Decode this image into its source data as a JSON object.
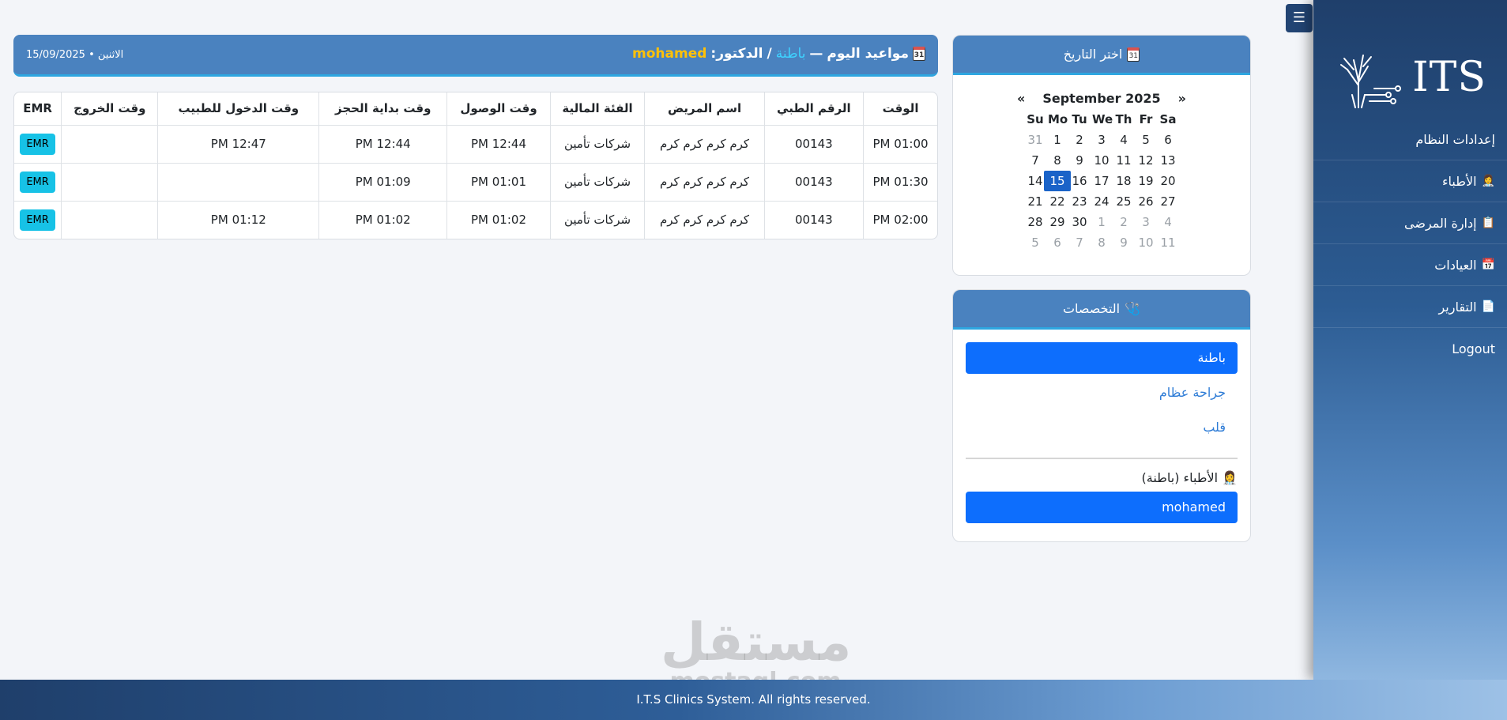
{
  "sidebar": {
    "toggle_icon": "☰",
    "logo_text": "ITS",
    "items": [
      {
        "label": "إعدادات النظام",
        "icon": ""
      },
      {
        "label": "الأطباء",
        "icon": "👩‍⚕️"
      },
      {
        "label": "إدارة المرضى",
        "icon": "📋"
      },
      {
        "label": "العيادات",
        "icon": "📅"
      },
      {
        "label": "التقارير",
        "icon": "📄"
      },
      {
        "label": "Logout",
        "icon": ""
      }
    ]
  },
  "header": {
    "title": "مواعيد اليوم",
    "dash": "—",
    "specialty": "باطنة",
    "separator": "/",
    "doctor_label": "الدكتور:",
    "doctor_name": "mohamed",
    "date": "الاثنين • 15/09/2025",
    "calendar_icon_day": "31"
  },
  "table": {
    "columns": [
      "الوقت",
      "الرقم الطبي",
      "اسم المريض",
      "الفئة المالية",
      "وقت الوصول",
      "وقت بداية الحجز",
      "وقت الدخول للطبيب",
      "وقت الخروج",
      "EMR"
    ],
    "rows": [
      {
        "time": "01:00 PM",
        "mrn": "00143",
        "name": "كرم كرم كرم كرم",
        "category": "شركات تأمين",
        "arrival": "12:44 PM",
        "booking_start": "12:44 PM",
        "doctor_in": "12:47 PM",
        "exit": "",
        "emr": "EMR"
      },
      {
        "time": "01:30 PM",
        "mrn": "00143",
        "name": "كرم كرم كرم كرم",
        "category": "شركات تأمين",
        "arrival": "01:01 PM",
        "booking_start": "01:09 PM",
        "doctor_in": "",
        "exit": "",
        "emr": "EMR"
      },
      {
        "time": "02:00 PM",
        "mrn": "00143",
        "name": "كرم كرم كرم كرم",
        "category": "شركات تأمين",
        "arrival": "01:02 PM",
        "booking_start": "01:02 PM",
        "doctor_in": "01:12 PM",
        "exit": "",
        "emr": "EMR"
      }
    ]
  },
  "calendar": {
    "title": "اختر التاريخ",
    "month_label": "September 2025",
    "prev": "«",
    "next": "»",
    "weekdays": [
      "Su",
      "Mo",
      "Tu",
      "We",
      "Th",
      "Fr",
      "Sa"
    ],
    "days": [
      {
        "d": "31",
        "m": true
      },
      {
        "d": "1"
      },
      {
        "d": "2"
      },
      {
        "d": "3"
      },
      {
        "d": "4"
      },
      {
        "d": "5"
      },
      {
        "d": "6"
      },
      {
        "d": "7"
      },
      {
        "d": "8"
      },
      {
        "d": "9"
      },
      {
        "d": "10"
      },
      {
        "d": "11"
      },
      {
        "d": "12"
      },
      {
        "d": "13"
      },
      {
        "d": "14"
      },
      {
        "d": "15",
        "sel": true
      },
      {
        "d": "16"
      },
      {
        "d": "17"
      },
      {
        "d": "18"
      },
      {
        "d": "19"
      },
      {
        "d": "20"
      },
      {
        "d": "21"
      },
      {
        "d": "22"
      },
      {
        "d": "23"
      },
      {
        "d": "24"
      },
      {
        "d": "25"
      },
      {
        "d": "26"
      },
      {
        "d": "27"
      },
      {
        "d": "28"
      },
      {
        "d": "29"
      },
      {
        "d": "30"
      },
      {
        "d": "1",
        "m": true
      },
      {
        "d": "2",
        "m": true
      },
      {
        "d": "3",
        "m": true
      },
      {
        "d": "4",
        "m": true
      },
      {
        "d": "5",
        "m": true
      },
      {
        "d": "6",
        "m": true
      },
      {
        "d": "7",
        "m": true
      },
      {
        "d": "8",
        "m": true
      },
      {
        "d": "9",
        "m": true
      },
      {
        "d": "10",
        "m": true
      },
      {
        "d": "11",
        "m": true
      }
    ]
  },
  "specialties": {
    "title": "التخصصات",
    "items": [
      {
        "label": "باطنة",
        "active": true
      },
      {
        "label": "جراحة عظام",
        "active": false
      },
      {
        "label": "قلب",
        "active": false
      }
    ],
    "doctors_label": "الأطباء (باطنة)",
    "doctors": [
      "mohamed"
    ]
  },
  "watermark": {
    "ar": "مستقل",
    "en": "mostaql.com"
  },
  "footer": {
    "text": "I.T.S Clinics System. All rights reserved."
  },
  "colors": {
    "primary": "#4a82bf",
    "accent": "#2ea6e0",
    "button": "#0d6efd",
    "emr": "#17c2e6",
    "doctor": "#ffc107"
  }
}
